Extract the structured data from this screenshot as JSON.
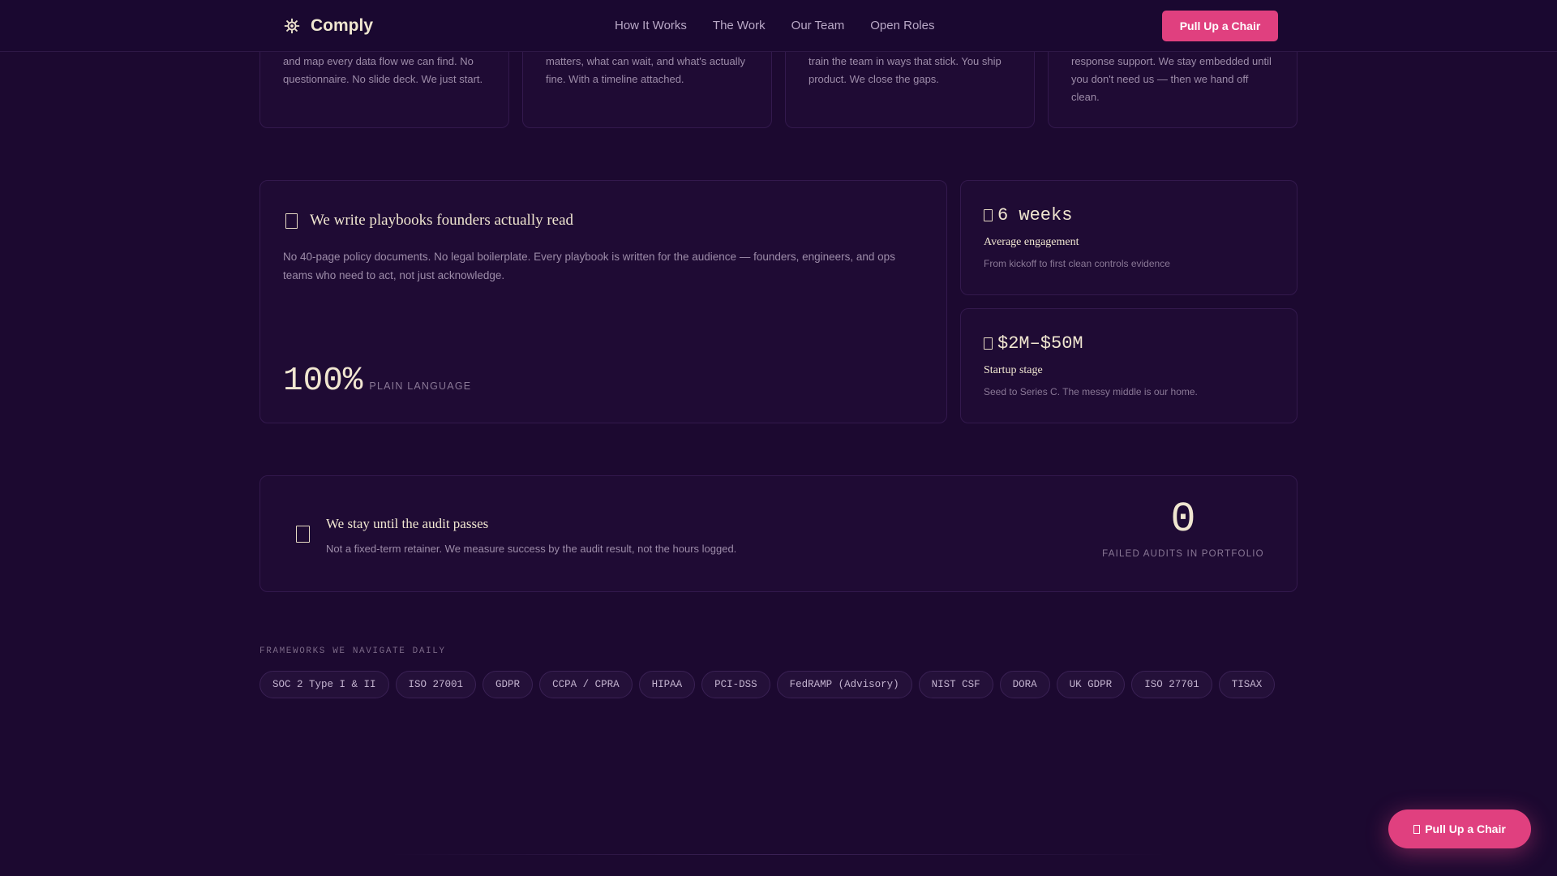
{
  "nav": {
    "brand": "Comply",
    "links": [
      "How It Works",
      "The Work",
      "Our Team",
      "Open Roles"
    ],
    "cta": "Pull Up a Chair"
  },
  "steps": [
    {
      "text": "and map every data flow we can find. No questionnaire. No slide deck. We just start."
    },
    {
      "text": "matters, what can wait, and what's actually fine. With a timeline attached."
    },
    {
      "text": "train the team in ways that stick. You ship product. We close the gaps."
    },
    {
      "text": "response support. We stay embedded until you don't need us — then we hand off clean."
    }
  ],
  "playbooks": {
    "title": "We write playbooks founders actually read",
    "body": "No 40-page policy documents. No legal boilerplate. Every playbook is written for the audience — founders, engineers, and ops teams who need to act, not just acknowledge.",
    "stat_value": "100%",
    "stat_label": "PLAIN LANGUAGE"
  },
  "engagement": {
    "value": "6 weeks",
    "label": "Average engagement",
    "sub": "From kickoff to first clean controls evidence"
  },
  "stage": {
    "value": "$2M–$50M",
    "label": "Startup stage",
    "sub": "Seed to Series C. The messy middle is our home."
  },
  "audit": {
    "title": "We stay until the audit passes",
    "body": "Not a fixed-term retainer. We measure success by the audit result, not the hours logged.",
    "stat_value": "0",
    "stat_label": "FAILED AUDITS IN PORTFOLIO"
  },
  "frameworks": {
    "heading": "FRAMEWORKS WE NAVIGATE DAILY",
    "items": [
      "SOC 2 Type I & II",
      "ISO 27001",
      "GDPR",
      "CCPA / CPRA",
      "HIPAA",
      "PCI-DSS",
      "FedRAMP (Advisory)",
      "NIST CSF",
      "DORA",
      "UK GDPR",
      "ISO 27701",
      "TISAX"
    ]
  },
  "floating_cta": "Pull Up a Chair",
  "colors": {
    "accent": "#e0407f",
    "background": "#1c0930",
    "cream": "#f0e6d0"
  }
}
